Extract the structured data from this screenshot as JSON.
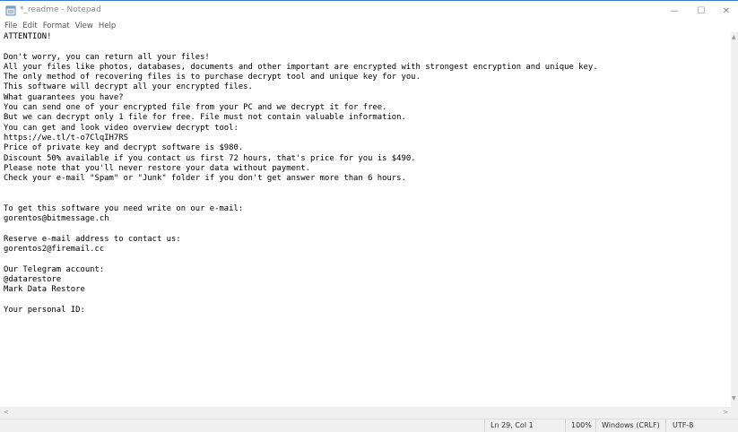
{
  "window": {
    "title": "*_readme - Notepad",
    "icon": "notepad-icon",
    "accent": "#3a7bd5"
  },
  "controls": {
    "minimize": "—",
    "maximize": "☐",
    "close": "✕"
  },
  "menu": {
    "file": "File",
    "edit": "Edit",
    "format": "Format",
    "view": "View",
    "help": "Help"
  },
  "document": {
    "content": "ATTENTION!\n\nDon't worry, you can return all your files!\nAll your files like photos, databases, documents and other important are encrypted with strongest encryption and unique key.\nThe only method of recovering files is to purchase decrypt tool and unique key for you.\nThis software will decrypt all your encrypted files.\nWhat guarantees you have?\nYou can send one of your encrypted file from your PC and we decrypt it for free.\nBut we can decrypt only 1 file for free. File must not contain valuable information.\nYou can get and look video overview decrypt tool:\nhttps://we.tl/t-o7ClqIH7RS\nPrice of private key and decrypt software is $980.\nDiscount 50% available if you contact us first 72 hours, that's price for you is $490.\nPlease note that you'll never restore your data without payment.\nCheck your e-mail \"Spam\" or \"Junk\" folder if you don't get answer more than 6 hours.\n\n\nTo get this software you need write on our e-mail:\ngorentos@bitmessage.ch\n\nReserve e-mail address to contact us:\ngorentos2@firemail.cc\n\nOur Telegram account:\n@datarestore\nMark Data Restore\n\nYour personal ID:"
  },
  "status": {
    "position": "Ln 29, Col 1",
    "zoom": "100%",
    "line_ending": "Windows (CRLF)",
    "encoding": "UTF-8"
  }
}
